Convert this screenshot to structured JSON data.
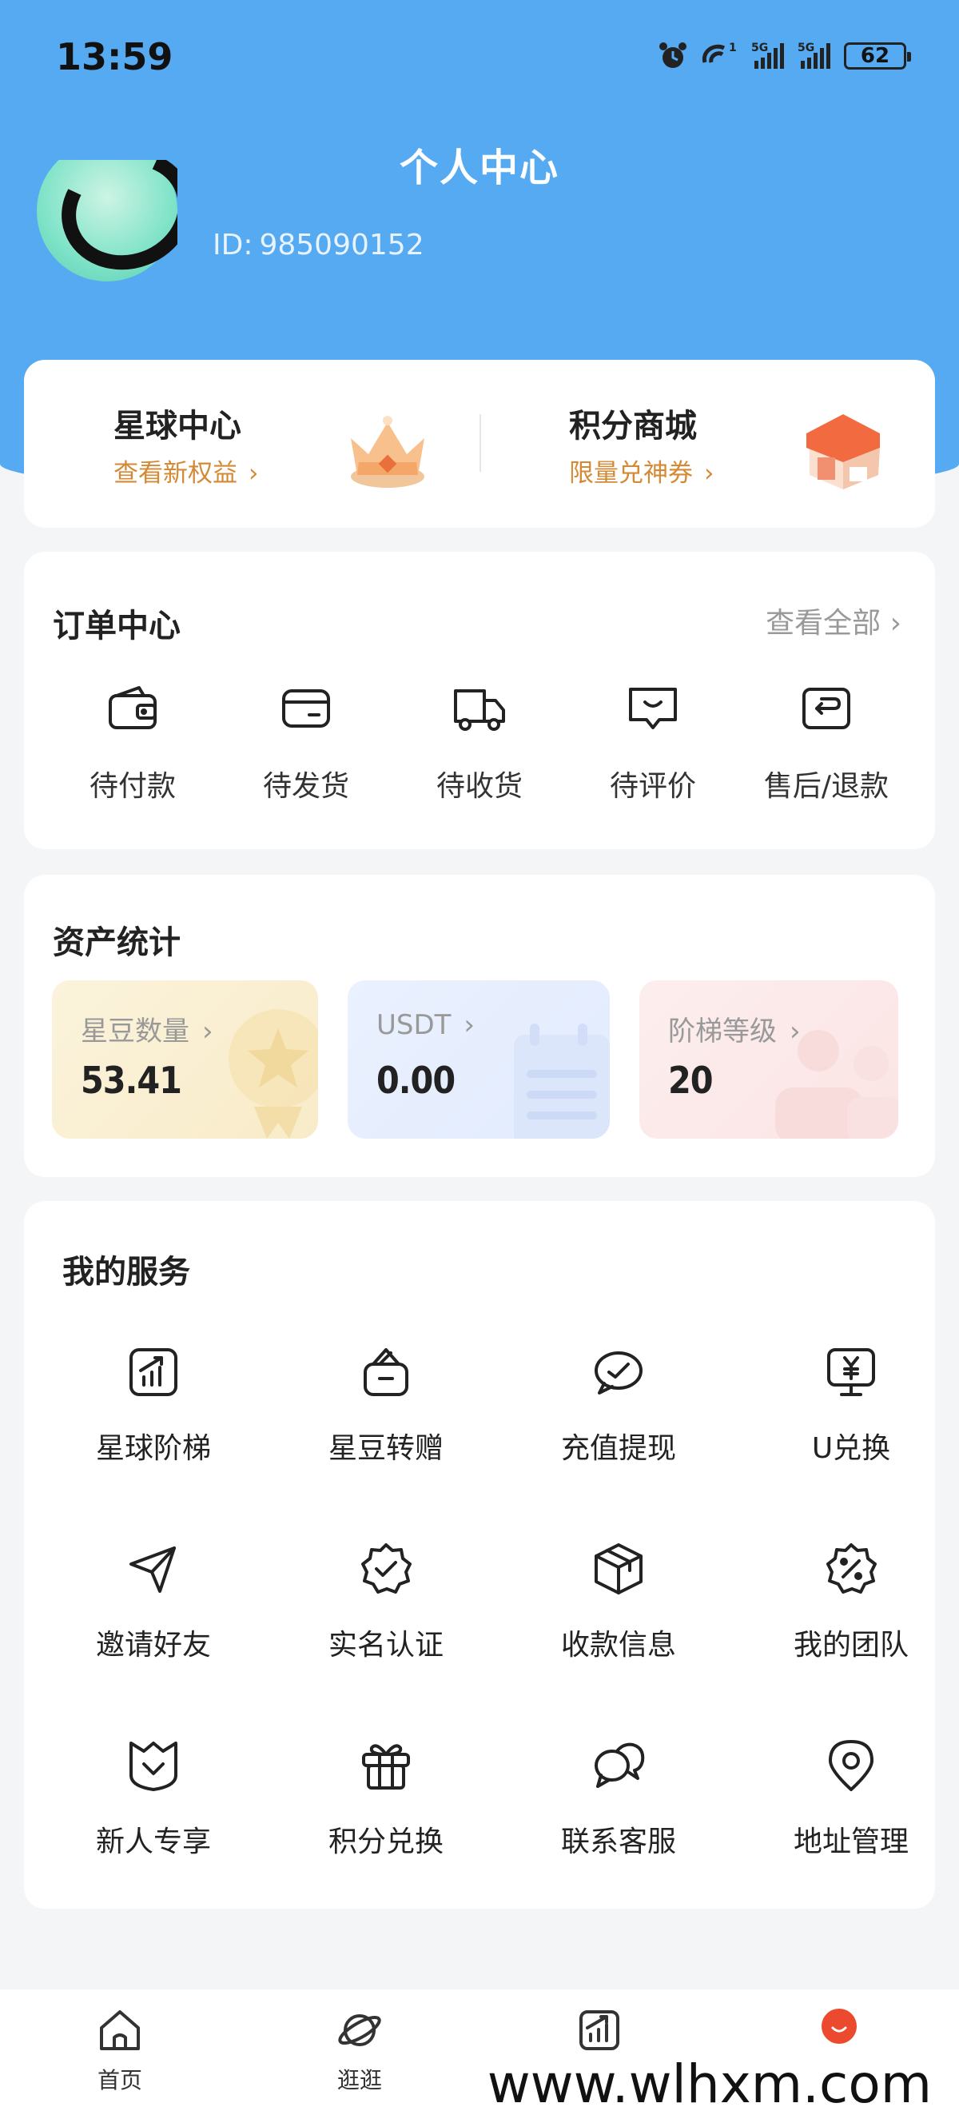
{
  "status_bar": {
    "time": "13:59",
    "battery": "62"
  },
  "header": {
    "title": "个人中心",
    "user_id_label": "ID:",
    "user_id": "985090152"
  },
  "promo": [
    {
      "title": "星球中心",
      "subtitle": "查看新权益",
      "chevron": "›"
    },
    {
      "title": "积分商城",
      "subtitle": "限量兑神券",
      "chevron": "›"
    }
  ],
  "orders": {
    "title": "订单中心",
    "see_all": "查看全部 ›",
    "items": [
      {
        "label": "待付款",
        "icon": "wallet-icon"
      },
      {
        "label": "待发货",
        "icon": "card-icon"
      },
      {
        "label": "待收货",
        "icon": "truck-icon"
      },
      {
        "label": "待评价",
        "icon": "comment-icon"
      },
      {
        "label": "售后/退款",
        "icon": "return-icon"
      }
    ]
  },
  "assets": {
    "title": "资产统计",
    "items": [
      {
        "label": "星豆数量",
        "value": "53.41",
        "chevron": "›",
        "color": "#fbf1d6"
      },
      {
        "label": "USDT",
        "value": "0.00",
        "chevron": "›",
        "color": "#e7efff"
      },
      {
        "label": "阶梯等级",
        "value": "20",
        "chevron": "›",
        "color": "#fde9ea"
      }
    ]
  },
  "services": {
    "title": "我的服务",
    "items": [
      {
        "label": "星球阶梯",
        "icon": "chart-up-icon"
      },
      {
        "label": "星豆转赠",
        "icon": "gift-card-icon"
      },
      {
        "label": "充值提现",
        "icon": "chat-check-icon"
      },
      {
        "label": "U兑换",
        "icon": "yen-monitor-icon"
      },
      {
        "label": "邀请好友",
        "icon": "paper-plane-icon"
      },
      {
        "label": "实名认证",
        "icon": "verified-badge-icon"
      },
      {
        "label": "收款信息",
        "icon": "box-icon"
      },
      {
        "label": "我的团队",
        "icon": "percent-badge-icon"
      },
      {
        "label": "新人专享",
        "icon": "shield-heart-icon"
      },
      {
        "label": "积分兑换",
        "icon": "gift-icon"
      },
      {
        "label": "联系客服",
        "icon": "chat-bubbles-icon"
      },
      {
        "label": "地址管理",
        "icon": "location-pin-icon"
      }
    ]
  },
  "bottom_nav": [
    {
      "label": "首页",
      "icon": "home-icon"
    },
    {
      "label": "逛逛",
      "icon": "planet-icon"
    },
    {
      "label": "",
      "icon": "chart-icon"
    },
    {
      "label": "",
      "icon": "profile-dot-icon"
    }
  ],
  "watermark": "www.wlhxm.com",
  "colors": {
    "header_blue": "#55aaf2",
    "accent_orange": "#d48a35",
    "profile_red": "#ec4a2e"
  }
}
